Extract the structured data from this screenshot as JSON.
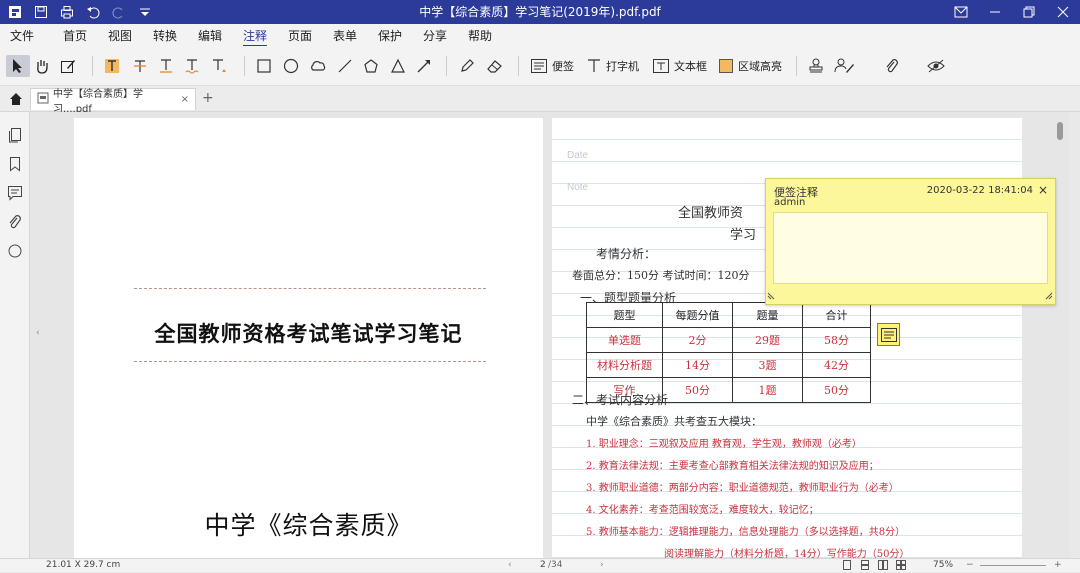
{
  "window": {
    "title": "中学【综合素质】学习笔记(2019年).pdf.pdf"
  },
  "menu": [
    "文件",
    "首页",
    "视图",
    "转换",
    "编辑",
    "注释",
    "页面",
    "表单",
    "保护",
    "分享",
    "帮助"
  ],
  "menu_active": "注释",
  "toolbar": {
    "sticky_label": "便签",
    "typewriter_label": "打字机",
    "textbox_label": "文本框",
    "area_highlight_label": "区域高亮"
  },
  "tab": {
    "title": "中学【综合素质】学习....pdf",
    "close": "×",
    "add": "+"
  },
  "page1": {
    "title": "全国教师资格考试笔试学习笔记",
    "subtitle": "中学《综合素质》"
  },
  "page2": {
    "date_label": "Date",
    "note_label": "Note",
    "heading1": "全国教师资",
    "heading2": "学习",
    "lines": {
      "l1": "考情分析：",
      "l2": "卷面总分：150分   考试时间：120分",
      "l3": "一、题型题量分析",
      "l4": "二、考试内容分析",
      "l5": "中学《综合素质》共考查五大模块：",
      "l6": "1. 职业理念：三观叙及应用  教育观，学生观，教师观（必考）",
      "l7": "2. 教育法律法规：主要考查心部教育相关法律法规的知识及应用；",
      "l8": "3. 教师职业道德：两部分内容：职业道德规范，教师职业行为（必考）",
      "l9": "4. 文化素养：考查范围较宽泛，难度较大，较记忆；",
      "l10": "5. 教师基本能力：逻辑推理能力，信息处理能力（多以选择题，共8分）",
      "l11": "阅读理解能力（材料分析题，14分）写作能力（50分）"
    },
    "table": {
      "headers": [
        "题型",
        "每题分值",
        "题量",
        "合计"
      ],
      "rows": [
        [
          "单选题",
          "2分",
          "29题",
          "58分"
        ],
        [
          "材料分析题",
          "14分",
          "3题",
          "42分"
        ],
        [
          "写作",
          "50分",
          "1题",
          "50分"
        ]
      ]
    }
  },
  "sticky": {
    "header": "便签注释",
    "author": "admin",
    "time": "2020-03-22 18:41:04",
    "close": "×"
  },
  "status": {
    "page_size": "21.01 X 29.7 cm",
    "page_current": "2",
    "page_total": "/34",
    "zoom": "75%"
  }
}
